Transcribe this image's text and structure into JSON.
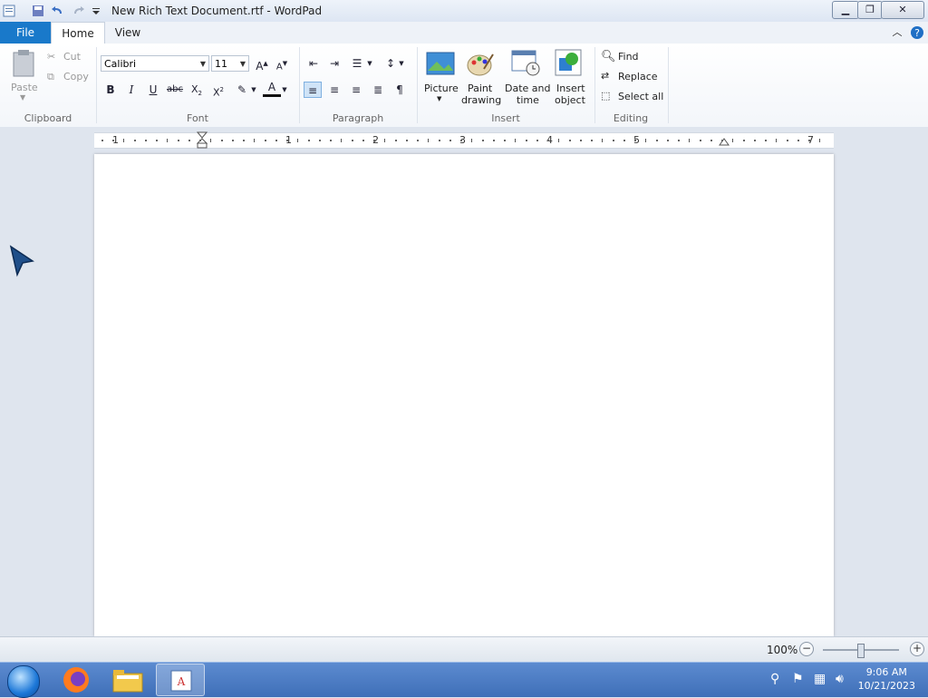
{
  "window": {
    "title": "New Rich Text Document.rtf - WordPad"
  },
  "tabs": [
    {
      "label": "File"
    },
    {
      "label": "Home"
    },
    {
      "label": "View"
    }
  ],
  "ribbon": {
    "clipboard": {
      "label": "Clipboard",
      "paste": "Paste",
      "cut": "Cut",
      "copy": "Copy"
    },
    "font": {
      "label": "Font",
      "family": "Calibri",
      "size": "11"
    },
    "paragraph": {
      "label": "Paragraph"
    },
    "insert": {
      "label": "Insert",
      "picture": "Picture",
      "paint_1": "Paint",
      "paint_2": "drawing",
      "datetime_1": "Date and",
      "datetime_2": "time",
      "object_1": "Insert",
      "object_2": "object"
    },
    "editing": {
      "label": "Editing",
      "find": "Find",
      "replace": "Replace",
      "select_all": "Select all"
    }
  },
  "ruler": {
    "numbers": [
      "1",
      "1",
      "2",
      "3",
      "4",
      "5",
      "7"
    ]
  },
  "status": {
    "zoom": "100%",
    "zoom_minus": "−",
    "zoom_plus": "+"
  },
  "taskbar": {
    "time": "9:06 AM",
    "date": "10/21/2023"
  },
  "colors": {
    "accent": "#1979ca",
    "taskbar": "#4a7cc4"
  }
}
